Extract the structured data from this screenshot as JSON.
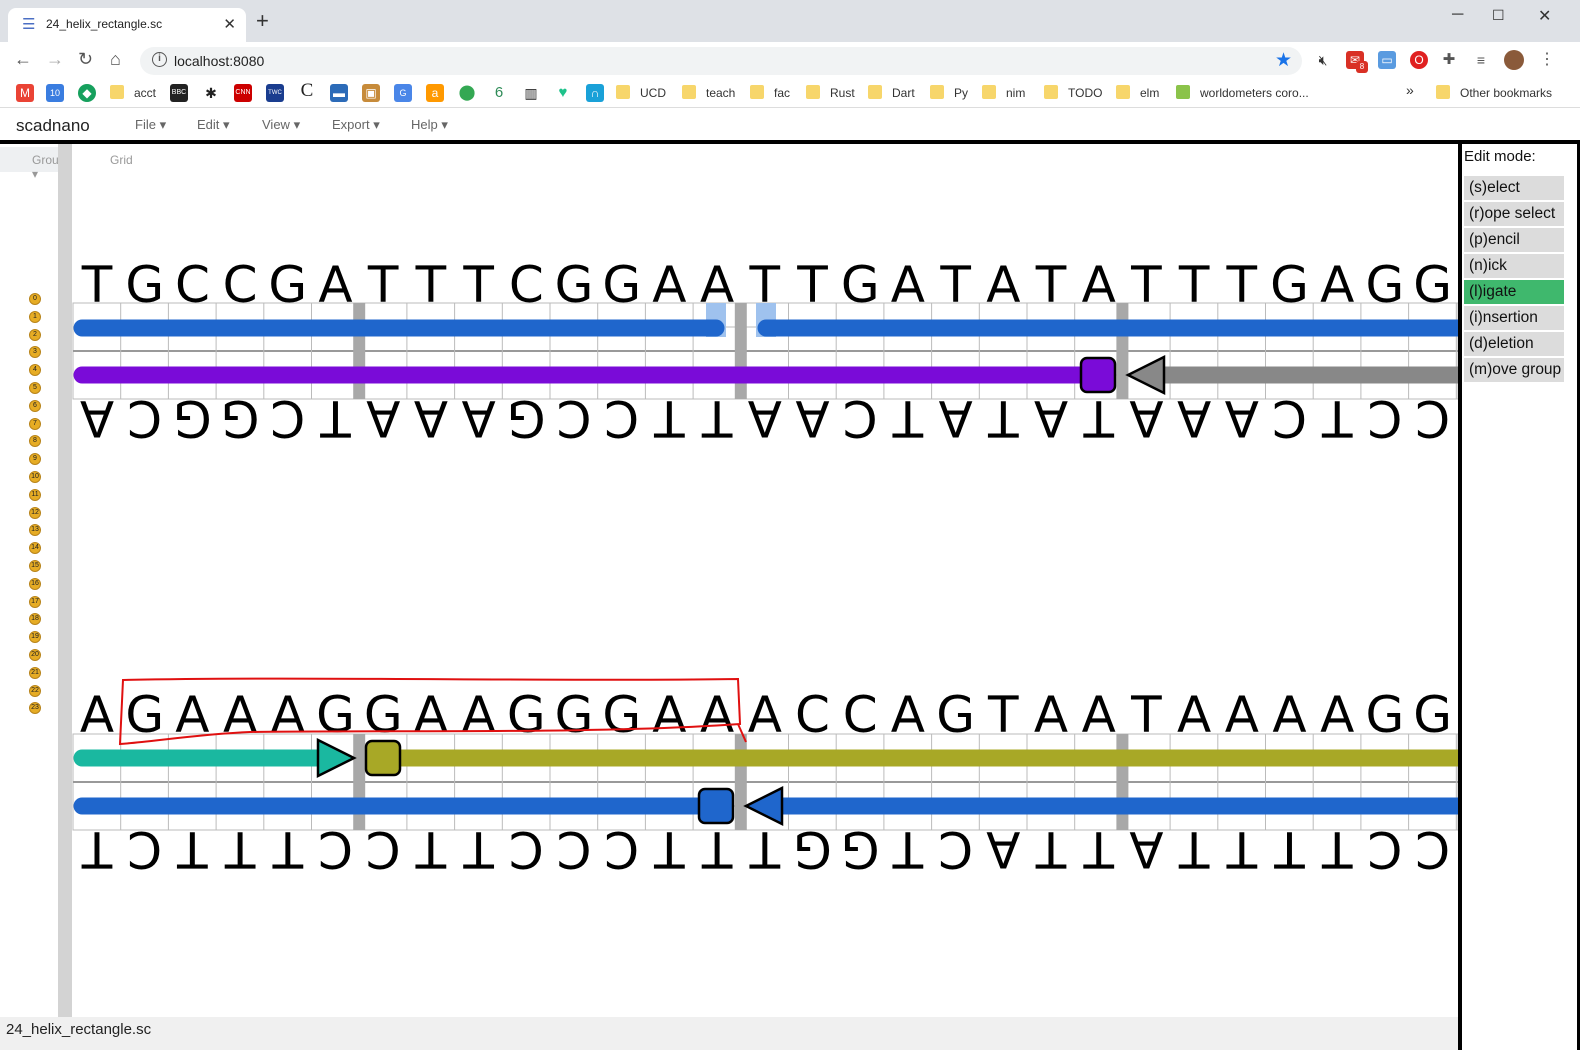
{
  "browser": {
    "tab_title": "24_helix_rectangle.sc",
    "new_tab": "+",
    "url": "localhost:8080",
    "ext_badge": "8",
    "bookmarks": [
      "acct",
      "UCD",
      "teach",
      "fac",
      "Rust",
      "Dart",
      "Py",
      "nim",
      "TODO",
      "elm",
      "worldometers coro..."
    ],
    "other_bookmarks": "Other bookmarks",
    "overflow": "»"
  },
  "app": {
    "name": "scadnano",
    "menus": [
      "File",
      "Edit",
      "View",
      "Export",
      "Help"
    ],
    "group_label": "Group",
    "grid_label": "Grid",
    "helix_indices": [
      "0",
      "1",
      "2",
      "3",
      "4",
      "5",
      "6",
      "7",
      "8",
      "9",
      "10",
      "11",
      "12",
      "13",
      "14",
      "15",
      "16",
      "17",
      "18",
      "19",
      "20",
      "21",
      "22",
      "23"
    ],
    "helix0": {
      "top_seq": "TGCCGATTTCGGAATTGATATATTTGAGGTT",
      "bottom_seq": "ACGGCTAAAGCCTTAACTATATAAACTCCAA"
    },
    "helix1": {
      "top_seq": "AGAAAGGAAGGGAAACCAGTAATAAAAGG",
      "bottom_seq": "TCTTTCCTTCCCTTTGGTCATTATTTTCC"
    },
    "colors": {
      "blue": "#1f66cc",
      "purple": "#7a0bd8",
      "gray": "#888888",
      "teal": "#1ab8a0",
      "olive": "#a8a826",
      "annotation": "#e01010",
      "active_mode": "#3fb86d"
    },
    "edit_mode_title": "Edit mode:",
    "edit_modes": [
      "(s)elect",
      "(r)ope select",
      "(p)encil",
      "(n)ick",
      "(l)igate",
      "(i)nsertion",
      "(d)eletion",
      "(m)ove group"
    ],
    "selected_mode": "(l)igate",
    "filename": "24_helix_rectangle.sc"
  }
}
